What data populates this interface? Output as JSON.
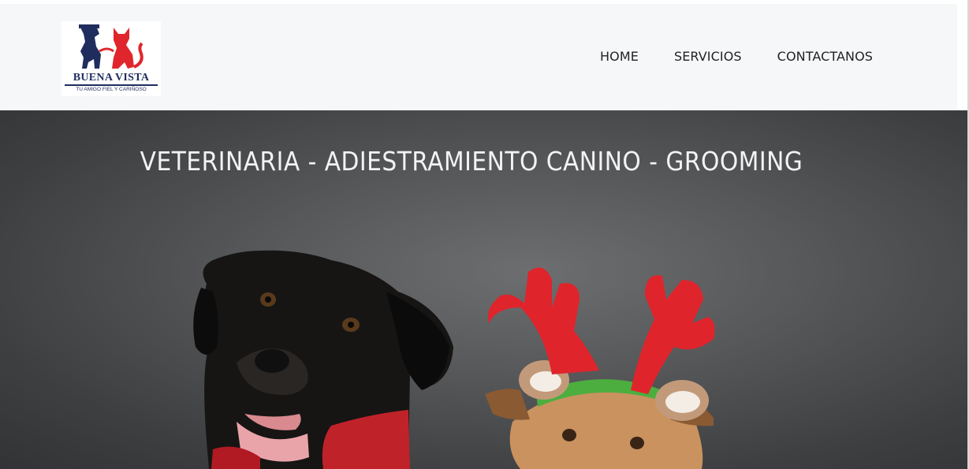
{
  "brand": {
    "name": "BUENA VISTA",
    "tagline": "TU AMIGO FIEL Y CARIÑOSO"
  },
  "nav": {
    "items": [
      {
        "label": "HOME"
      },
      {
        "label": "SERVICIOS"
      },
      {
        "label": "CONTACTANOS"
      }
    ]
  },
  "hero": {
    "title": "VETERINARIA - ADIESTRAMIENTO CANINO - GROOMING"
  },
  "colors": {
    "header_bg": "#f6f7f9",
    "logo_navy": "#1f2d5e",
    "logo_red": "#e0262c",
    "antler_red": "#e0242c"
  }
}
